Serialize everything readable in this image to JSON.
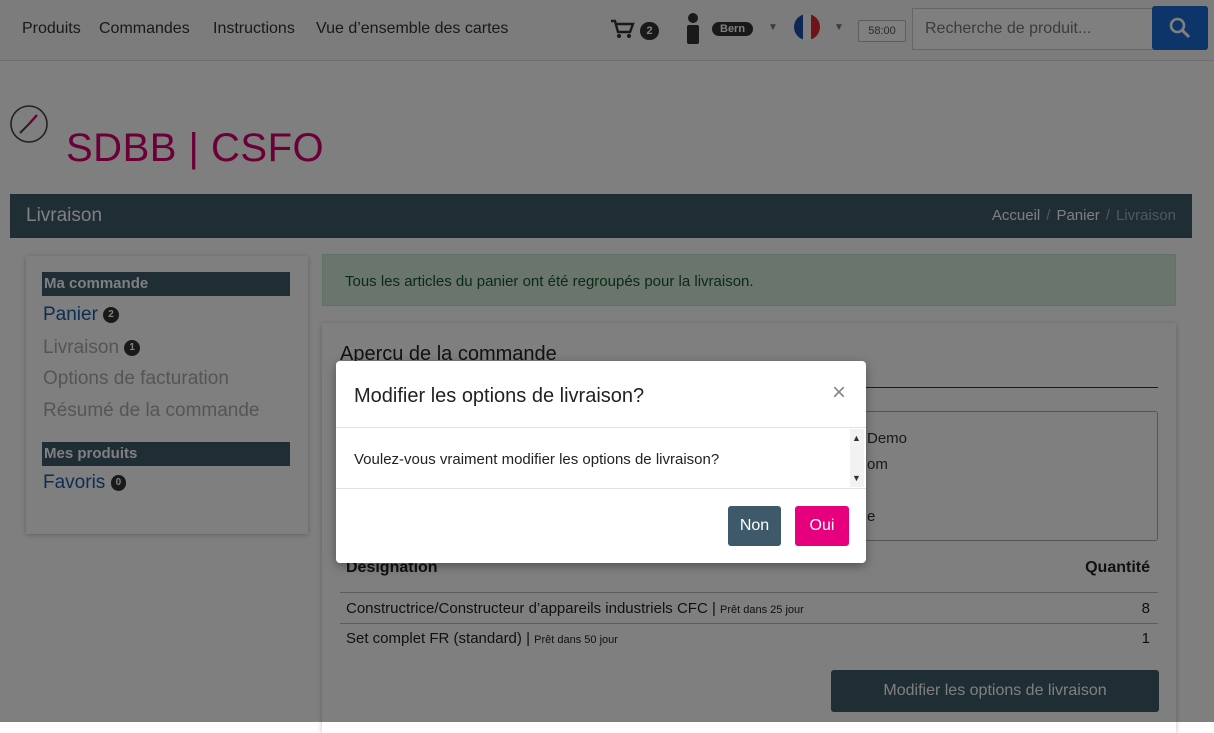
{
  "nav": {
    "links": [
      "Produits",
      "Commandes",
      "Instructions",
      "Vue d’ensemble des cartes"
    ],
    "cart_count": "2",
    "user_location": "Bern",
    "timer": "58:00",
    "search_placeholder": "Recherche de produit..."
  },
  "logo": {
    "text": "SDBB | CSFO",
    "color": "#d4006e"
  },
  "titlebar": {
    "title": "Livraison",
    "breadcrumb": [
      "Accueil",
      "Panier",
      "Livraison"
    ]
  },
  "sidebar": {
    "section1": "Ma commande",
    "items": [
      {
        "label": "Panier",
        "badge": "2"
      },
      {
        "label": "Livraison",
        "badge": "1"
      },
      {
        "label": "Options de facturation"
      },
      {
        "label": "Résumé de la commande"
      }
    ],
    "section2": "Mes produits",
    "products": [
      {
        "label": "Favoris",
        "badge": "0"
      }
    ]
  },
  "alert": {
    "text": "Tous les articles du panier ont été regroupés pour la livraison."
  },
  "order": {
    "title": "Apercu de la commande",
    "address_lines": [
      "Demo",
      "om",
      "e"
    ],
    "columns": [
      "Designation",
      "Quantité"
    ],
    "rows": [
      {
        "name": "Constructrice/Constructeur d’appareils industriels CFC |",
        "note": "Prêt dans 25 jour",
        "qty": "8"
      },
      {
        "name": "Set complet FR (standard) |",
        "note": "Prêt dans 50 jour",
        "qty": "1"
      }
    ],
    "modify_button": "Modifier les options de livraison"
  },
  "modal": {
    "title": "Modifier les options de livraison?",
    "close": "×",
    "body": "Voulez-vous vraiment modifier les options de livraison?",
    "no_label": "Non",
    "yes_label": "Oui"
  },
  "colors": {
    "primary": "#3e5a6a",
    "accent": "#e6007e",
    "search": "#1a6bd3",
    "success_bg": "#d4edda"
  }
}
